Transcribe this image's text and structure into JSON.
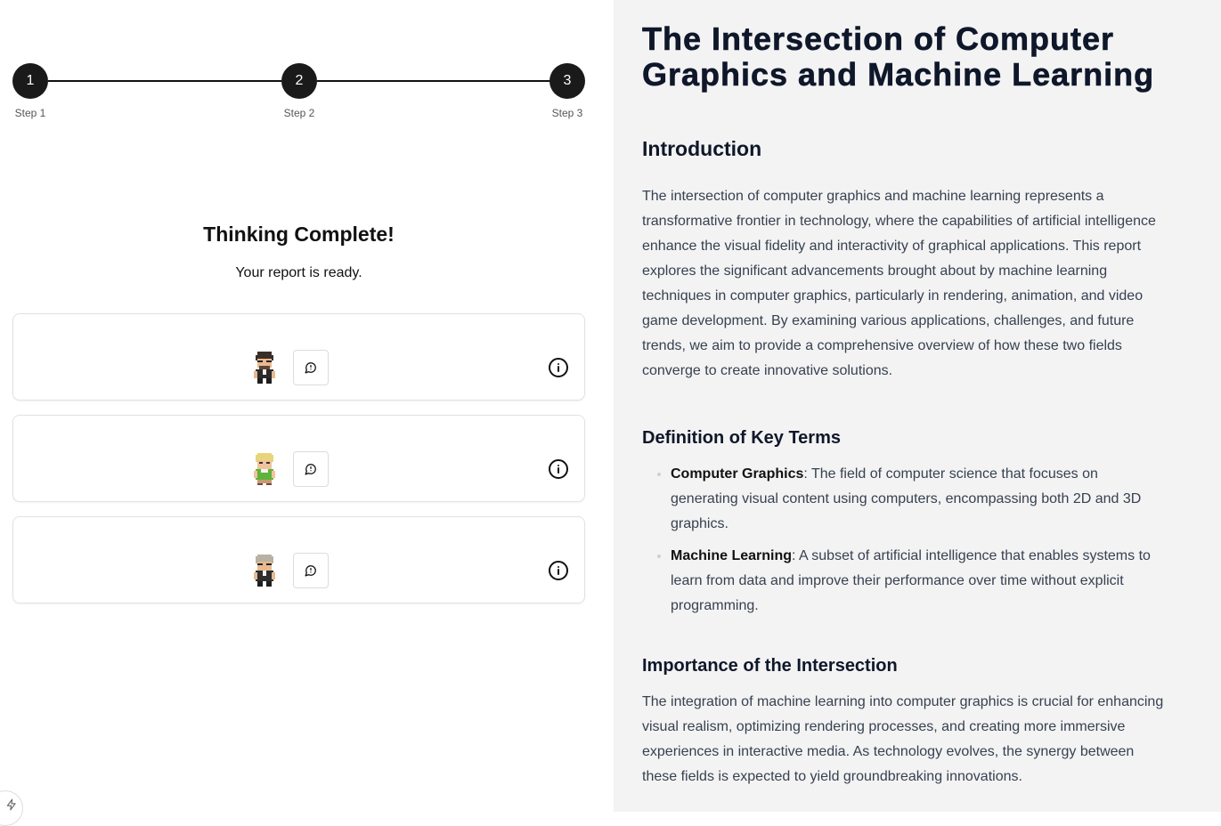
{
  "stepper": {
    "steps": [
      {
        "number": "1",
        "label": "Step 1"
      },
      {
        "number": "2",
        "label": "Step 2"
      },
      {
        "number": "3",
        "label": "Step 3"
      }
    ]
  },
  "status": {
    "title": "Thinking Complete!",
    "subtitle": "Your report is ready."
  },
  "agents": [
    {
      "avatar": "dark-haired-glasses-character",
      "chat_icon": "chat-bubble-icon",
      "info_icon": "info-icon"
    },
    {
      "avatar": "blonde-green-shirt-character",
      "chat_icon": "chat-bubble-icon",
      "info_icon": "info-icon"
    },
    {
      "avatar": "grey-haired-glasses-character",
      "chat_icon": "chat-bubble-icon",
      "info_icon": "info-icon"
    }
  ],
  "report": {
    "title": "The Intersection of Computer Graphics and Machine Learning",
    "intro_heading": "Introduction",
    "intro_text": "The intersection of computer graphics and machine learning represents a transformative frontier in technology, where the capabilities of artificial intelligence enhance the visual fidelity and interactivity of graphical applications. This report explores the significant advancements brought about by machine learning techniques in computer graphics, particularly in rendering, animation, and video game development. By examining various applications, challenges, and future trends, we aim to provide a comprehensive overview of how these two fields converge to create innovative solutions.",
    "terms_heading": "Definition of Key Terms",
    "terms": [
      {
        "term": "Computer Graphics",
        "definition": ": The field of computer science that focuses on generating visual content using computers, encompassing both 2D and 3D graphics."
      },
      {
        "term": "Machine Learning",
        "definition": ": A subset of artificial intelligence that enables systems to learn from data and improve their performance over time without explicit programming."
      }
    ],
    "importance_heading": "Importance of the Intersection",
    "importance_text": "The integration of machine learning into computer graphics is crucial for enhancing visual realism, optimizing rendering processes, and creating more immersive experiences in interactive media. As technology evolves, the synergy between these fields is expected to yield groundbreaking innovations."
  }
}
